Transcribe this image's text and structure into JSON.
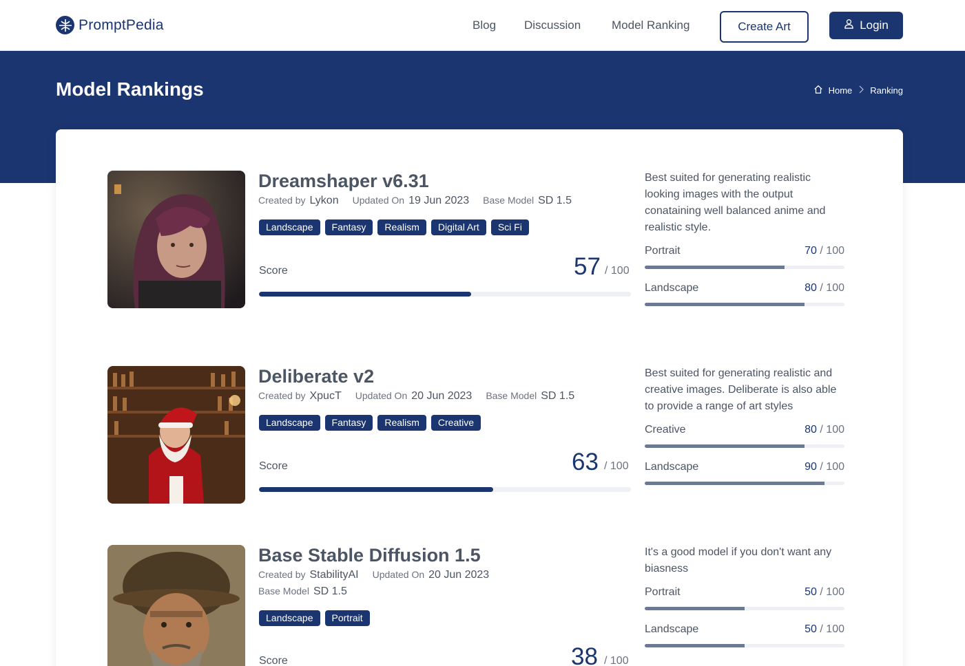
{
  "header": {
    "brand": "PromptPedia",
    "nav": [
      {
        "label": "Blog"
      },
      {
        "label": "Discussion"
      },
      {
        "label": "Model Ranking"
      }
    ],
    "create_art_label": "Create Art",
    "login_label": "Login"
  },
  "hero": {
    "title": "Model Rankings",
    "breadcrumb": {
      "home": "Home",
      "current": "Ranking"
    }
  },
  "labels": {
    "created_by": "Created by",
    "updated_on": "Updated On",
    "base_model": "Base Model",
    "score": "Score",
    "score_max": "/ 100",
    "sub_max": "/ 100"
  },
  "models": [
    {
      "name": "Dreamshaper v6.31",
      "creator": "Lykon",
      "updated": "19 Jun 2023",
      "base_model": "SD 1.5",
      "tags": [
        "Landscape",
        "Fantasy",
        "Realism",
        "Digital Art",
        "Sci Fi"
      ],
      "score": 57,
      "description": "Best suited for generating realistic looking images with the output conataining well balanced anime and realistic style.",
      "sub_scores": [
        {
          "label": "Portrait",
          "value": 70
        },
        {
          "label": "Landscape",
          "value": 80
        }
      ]
    },
    {
      "name": "Deliberate v2",
      "creator": "XpucT",
      "updated": "20 Jun 2023",
      "base_model": "SD 1.5",
      "tags": [
        "Landscape",
        "Fantasy",
        "Realism",
        "Creative"
      ],
      "score": 63,
      "description": "Best suited for generating realistic and creative images. Deliberate is also able to provide a range of art styles",
      "sub_scores": [
        {
          "label": "Creative",
          "value": 80
        },
        {
          "label": "Landscape",
          "value": 90
        }
      ]
    },
    {
      "name": "Base Stable Diffusion 1.5",
      "creator": "StabilityAI",
      "updated": "20 Jun 2023",
      "base_model": "SD 1.5",
      "tags": [
        "Landscape",
        "Portrait"
      ],
      "score": 38,
      "description": "It's a good model if you don't want any biasness",
      "sub_scores": [
        {
          "label": "Portrait",
          "value": 50
        },
        {
          "label": "Landscape",
          "value": 50
        }
      ]
    }
  ],
  "colors": {
    "primary": "#1a3570",
    "sub_bar": "#6b7a90",
    "track": "#eef0f3"
  }
}
